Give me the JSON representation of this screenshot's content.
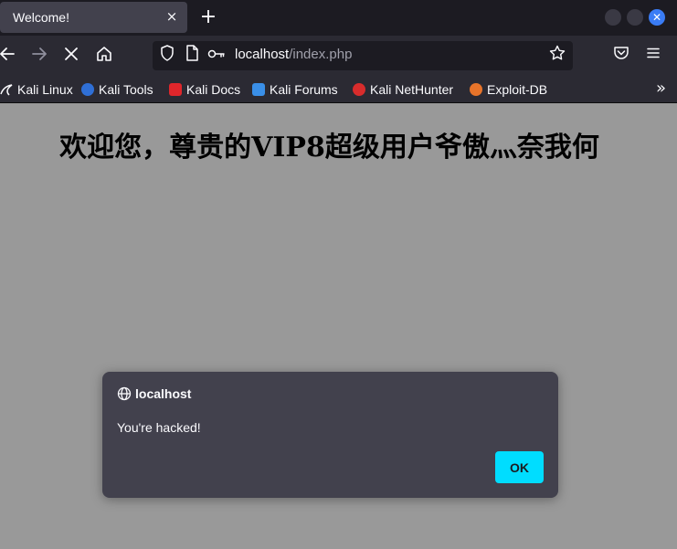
{
  "browser": {
    "tab_title": "Welcome!",
    "tab_close_glyph": "×",
    "new_tab_glyph": "+",
    "url_host": "localhost",
    "url_path": "/index.php"
  },
  "bookmarks": [
    {
      "label": "Kali Linux",
      "icon": "kali-dragon-icon",
      "color": "#fbfbfe"
    },
    {
      "label": "Kali Tools",
      "icon": "kali-tools-icon",
      "color": "#2f6fd6"
    },
    {
      "label": "Kali Docs",
      "icon": "kali-docs-icon",
      "color": "#e0262b"
    },
    {
      "label": "Kali Forums",
      "icon": "kali-forums-icon",
      "color": "#3a8fe8"
    },
    {
      "label": "Kali NetHunter",
      "icon": "kali-nethunter-icon",
      "color": "#d82c2c"
    },
    {
      "label": "Exploit-DB",
      "icon": "exploit-db-icon",
      "color": "#e8742a"
    }
  ],
  "page": {
    "heading": "欢迎您，尊贵的VIP8超级用户爷傲灬奈我何",
    "background": "#999999"
  },
  "dialog": {
    "origin": "localhost",
    "message": "You're hacked!",
    "ok_label": "OK",
    "accent": "#00ddff"
  }
}
